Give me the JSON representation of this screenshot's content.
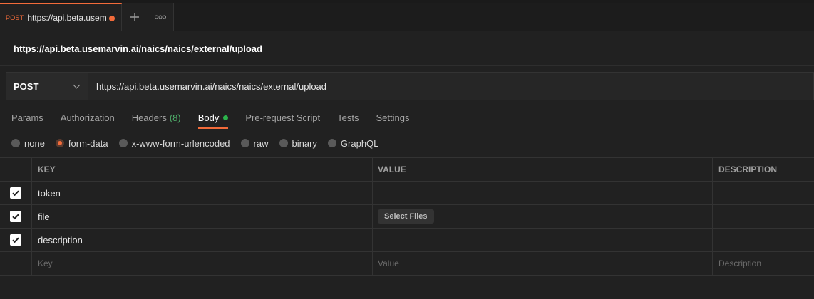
{
  "tab": {
    "method": "POST",
    "name": "https://api.beta.usem",
    "unsaved": true
  },
  "title": "https://api.beta.usemarvin.ai/naics/naics/external/upload",
  "request": {
    "method": "POST",
    "url": "https://api.beta.usemarvin.ai/naics/naics/external/upload"
  },
  "subtabs": [
    {
      "label": "Params"
    },
    {
      "label": "Authorization"
    },
    {
      "label": "Headers",
      "count": "(8)"
    },
    {
      "label": "Body",
      "active": true
    },
    {
      "label": "Pre-request Script"
    },
    {
      "label": "Tests"
    },
    {
      "label": "Settings"
    }
  ],
  "body_types": [
    "none",
    "form-data",
    "x-www-form-urlencoded",
    "raw",
    "binary",
    "GraphQL"
  ],
  "selected_body_type": "form-data",
  "table": {
    "headers": [
      "KEY",
      "VALUE",
      "DESCRIPTION"
    ],
    "rows": [
      {
        "key": "token",
        "checked": true
      },
      {
        "key": "file",
        "checked": true,
        "value_button": "Select Files"
      },
      {
        "key": "description",
        "checked": true
      }
    ],
    "placeholders": {
      "key": "Key",
      "value": "Value",
      "description": "Description"
    }
  },
  "colors": {
    "accent": "#f26b3a",
    "success": "#2bb34b",
    "background": "#212121"
  }
}
